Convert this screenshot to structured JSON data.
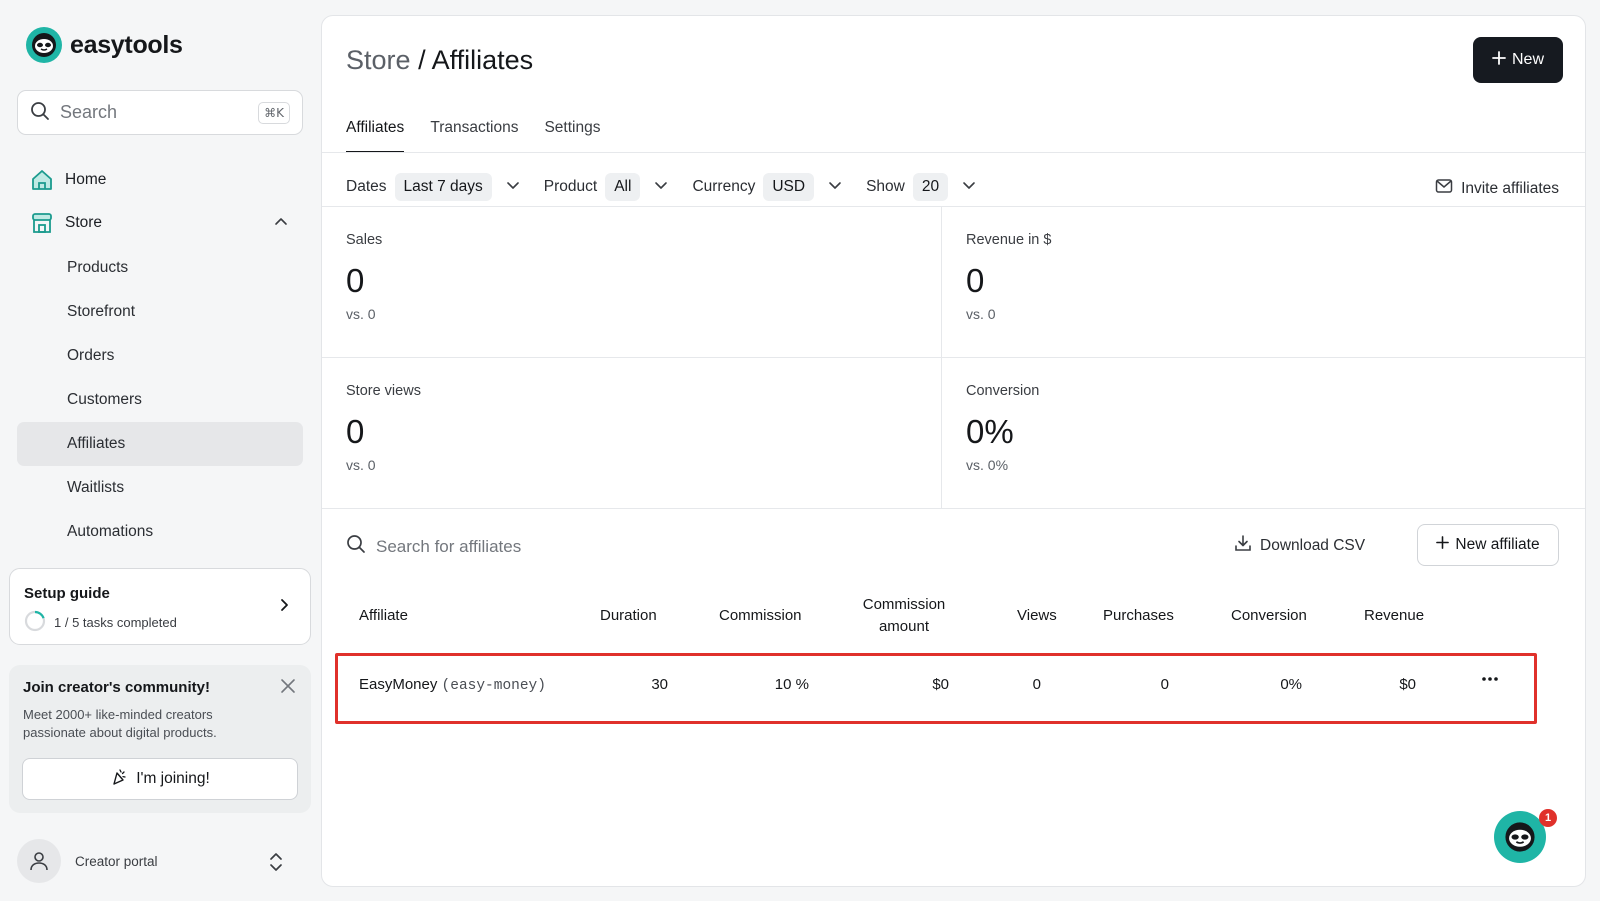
{
  "app": {
    "name": "easytools"
  },
  "search": {
    "placeholder": "Search",
    "shortcut": "⌘K"
  },
  "sidebar": {
    "items": [
      {
        "label": "Home",
        "icon": "home-icon"
      },
      {
        "label": "Store",
        "icon": "store-icon",
        "expanded": true
      }
    ],
    "store_items": [
      {
        "label": "Products"
      },
      {
        "label": "Storefront"
      },
      {
        "label": "Orders"
      },
      {
        "label": "Customers"
      },
      {
        "label": "Affiliates",
        "active": true
      },
      {
        "label": "Waitlists"
      },
      {
        "label": "Automations"
      }
    ],
    "setup_guide": {
      "title": "Setup guide",
      "progress_text": "1 / 5 tasks completed",
      "progress": 0.2
    },
    "community": {
      "title": "Join creator's community!",
      "description": "Meet 2000+ like-minded creators passionate about digital products.",
      "button": "I'm joining!"
    },
    "portal": {
      "label": "Creator portal"
    }
  },
  "header": {
    "breadcrumb_parent": "Store",
    "breadcrumb_sep": "/",
    "title": "Affiliates",
    "new_button": "New"
  },
  "tabs": [
    {
      "label": "Affiliates",
      "active": true
    },
    {
      "label": "Transactions"
    },
    {
      "label": "Settings"
    }
  ],
  "filters": {
    "dates": {
      "label": "Dates",
      "value": "Last 7 days"
    },
    "product": {
      "label": "Product",
      "value": "All"
    },
    "currency": {
      "label": "Currency",
      "value": "USD"
    },
    "show": {
      "label": "Show",
      "value": "20"
    },
    "invite": "Invite affiliates"
  },
  "stats": {
    "sales": {
      "label": "Sales",
      "value": "0",
      "compare": "vs. 0"
    },
    "revenue": {
      "label": "Revenue in $",
      "value": "0",
      "compare": "vs. 0"
    },
    "store_views": {
      "label": "Store views",
      "value": "0",
      "compare": "vs. 0"
    },
    "conversion": {
      "label": "Conversion",
      "value": "0%",
      "compare": "vs. 0%"
    }
  },
  "affiliates": {
    "search_placeholder": "Search for affiliates",
    "download_csv": "Download CSV",
    "new_affiliate": "New affiliate",
    "columns": {
      "affiliate": "Affiliate",
      "duration": "Duration",
      "commission": "Commission",
      "commission_amount_1": "Commission",
      "commission_amount_2": "amount",
      "views": "Views",
      "purchases": "Purchases",
      "conversion": "Conversion",
      "revenue": "Revenue"
    },
    "rows": [
      {
        "name": "EasyMoney",
        "slug": "(easy-money)",
        "duration": "30",
        "commission": "10 %",
        "commission_amount": "$0",
        "views": "0",
        "purchases": "0",
        "conversion": "0%",
        "revenue": "$0"
      }
    ]
  },
  "chat": {
    "badge": "1"
  },
  "colors": {
    "accent": "#1fb5a6",
    "primary_button": "#161a20",
    "highlight": "#e0312b"
  }
}
